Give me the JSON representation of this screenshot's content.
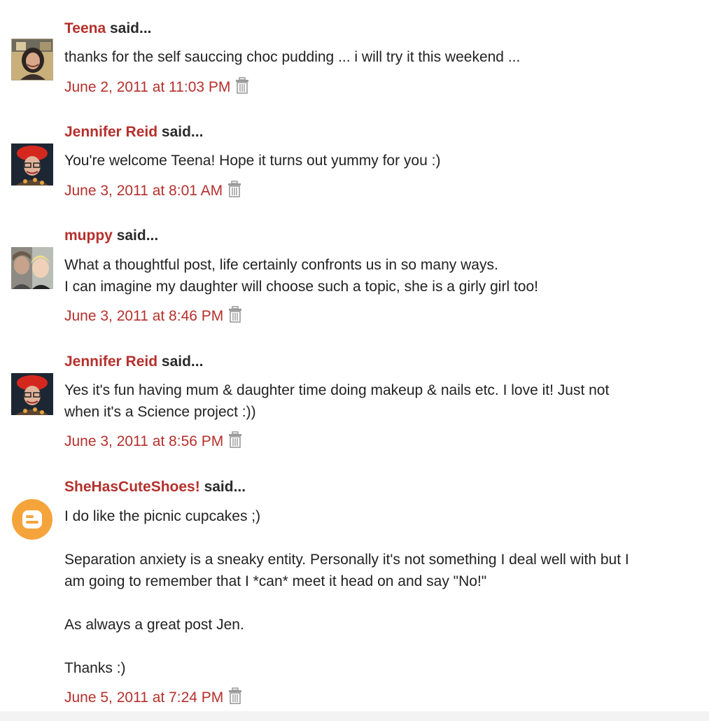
{
  "comments": [
    {
      "author": "Teena",
      "said": "said...",
      "body": [
        "thanks for the self sauccing choc pudding ... i will try it this weekend ..."
      ],
      "timestamp": "June 2, 2011 at 11:03 PM",
      "avatar_icon": "person-photo-icon"
    },
    {
      "author": "Jennifer Reid",
      "said": "said...",
      "body": [
        "You're welcome Teena! Hope it turns out yummy for you :)"
      ],
      "timestamp": "June 3, 2011 at 8:01 AM",
      "avatar_icon": "person-red-hat-photo-icon"
    },
    {
      "author": "muppy",
      "said": "said...",
      "body": [
        "What a thoughtful post, life certainly confronts us in so many ways.",
        "I can imagine my daughter will choose such a topic, she is a girly girl too!"
      ],
      "timestamp": "June 3, 2011 at 8:46 PM",
      "avatar_icon": "two-people-photo-icon"
    },
    {
      "author": "Jennifer Reid",
      "said": "said...",
      "body": [
        "Yes it's fun having mum & daughter time doing makeup & nails etc. I love it! Just not",
        "when it's a Science project :))"
      ],
      "timestamp": "June 3, 2011 at 8:56 PM",
      "avatar_icon": "person-red-hat-photo-icon"
    },
    {
      "author": "SheHasCuteShoes!",
      "said": "said...",
      "body": [
        "I do like the picnic cupcakes ;)",
        "Separation anxiety is a sneaky entity. Personally it's not something I deal well with but I",
        "am going to remember that I *can* meet it head on and say \"No!\"",
        "As always a great post Jen.",
        "Thanks :)"
      ],
      "timestamp": "June 5, 2011 at 7:24 PM",
      "avatar_icon": "blogger-logo-icon"
    }
  ],
  "colors": {
    "author": "#b5302c",
    "text": "#222222",
    "blogger_orange": "#f5a43b"
  },
  "icons": {
    "delete": "trash-icon"
  }
}
